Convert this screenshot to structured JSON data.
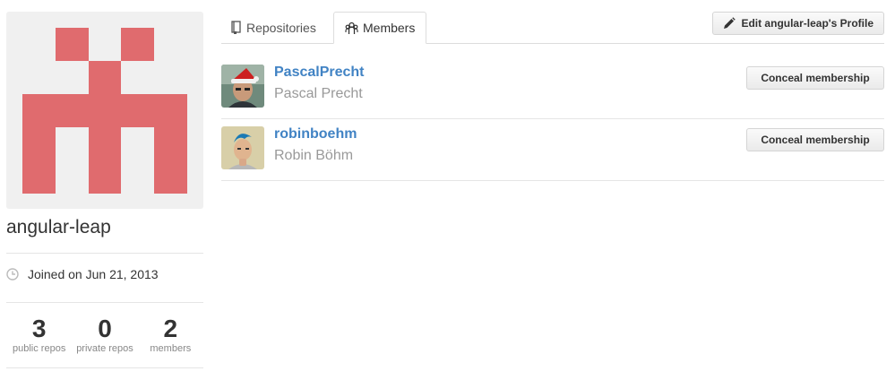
{
  "org": {
    "name": "angular-leap",
    "joined_text": "Joined on Jun 21, 2013",
    "avatar_color": "#e06b6e",
    "stats": [
      {
        "value": "3",
        "label": "public repos"
      },
      {
        "value": "0",
        "label": "private repos"
      },
      {
        "value": "2",
        "label": "members"
      }
    ]
  },
  "tabs": {
    "repositories": "Repositories",
    "members": "Members",
    "active": "members"
  },
  "edit_button": "Edit angular-leap's Profile",
  "members": [
    {
      "login": "PascalPrecht",
      "full_name": "Pascal Precht",
      "action": "Conceal membership"
    },
    {
      "login": "robinboehm",
      "full_name": "Robin Böhm",
      "action": "Conceal membership"
    }
  ],
  "colors": {
    "link": "#4183c4",
    "muted": "#999999"
  }
}
